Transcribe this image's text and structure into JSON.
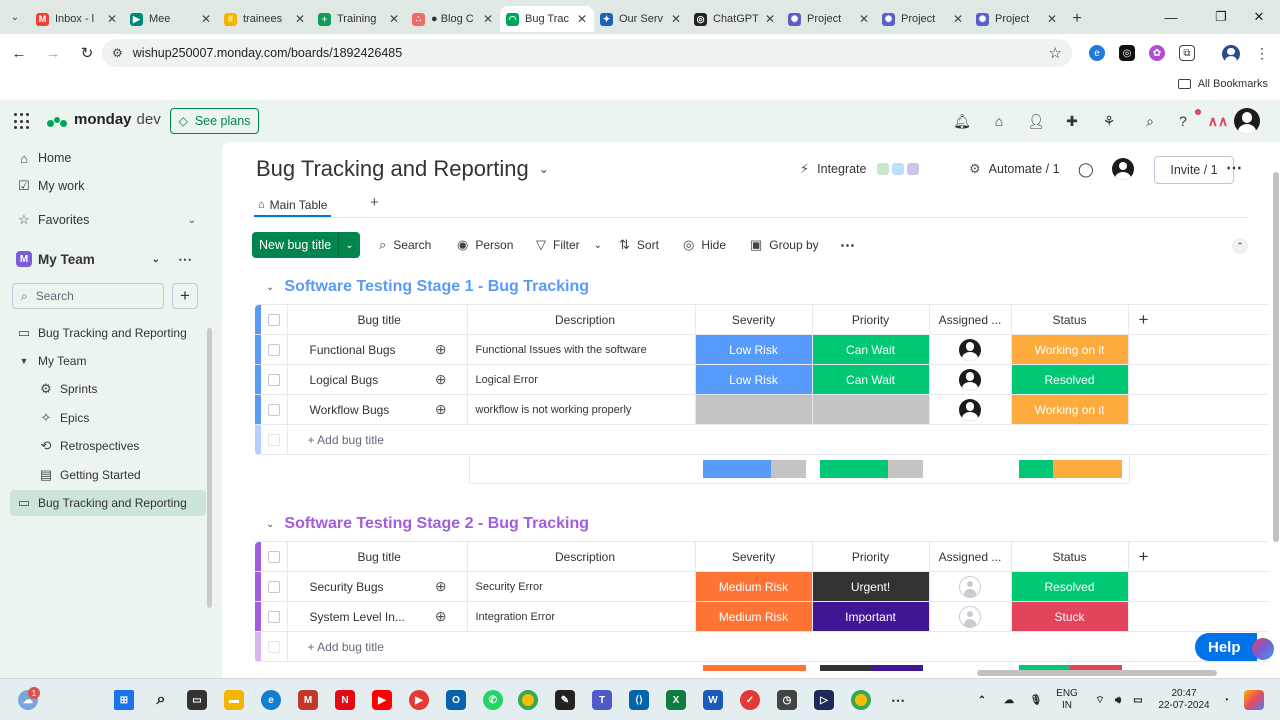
{
  "browser": {
    "tabs": [
      {
        "title": "Inbox - l",
        "color": "#ea4335",
        "glyph": "M"
      },
      {
        "title": "Mee",
        "color": "#00897b",
        "glyph": "▶"
      },
      {
        "title": "trainees",
        "color": "#f6b400",
        "glyph": "#"
      },
      {
        "title": "Training",
        "color": "#0f9d58",
        "glyph": "+"
      },
      {
        "title": "● Blog C",
        "color": "#f06a6a",
        "glyph": "∴"
      },
      {
        "title": "Bug Trac",
        "color": "#00a657",
        "glyph": "◠"
      },
      {
        "title": "Our Serv",
        "color": "#1e63b8",
        "glyph": "✦"
      },
      {
        "title": "ChatGPT",
        "color": "#222222",
        "glyph": "◎"
      },
      {
        "title": "Project",
        "color": "#5b5fc7",
        "glyph": "✺"
      },
      {
        "title": "Project",
        "color": "#5b5fc7",
        "glyph": "✺"
      },
      {
        "title": "Project",
        "color": "#5b5fc7",
        "glyph": "✺"
      }
    ],
    "url": "wishup250007.monday.com/boards/1892426485",
    "all_bookmarks": "All Bookmarks"
  },
  "topbar": {
    "brand": "monday",
    "product": "dev",
    "see_plans": "See plans"
  },
  "sidebar": {
    "home": "Home",
    "my_work": "My work",
    "favorites": "Favorites",
    "team": "My Team",
    "team_badge": "M",
    "search_placeholder": "Search",
    "items": [
      {
        "label": "Bug Tracking and Reporting"
      },
      {
        "label": "My Team"
      },
      {
        "label": "Sprints"
      },
      {
        "label": "Epics"
      },
      {
        "label": "Retrospectives"
      },
      {
        "label": "Getting Started"
      },
      {
        "label": "Bug Tracking and Reporting"
      }
    ]
  },
  "board": {
    "title": "Bug Tracking and Reporting",
    "integrate": "Integrate",
    "automate": "Automate / 1",
    "invite": "Invite / 1",
    "main_tab": "Main Table",
    "toolbar": {
      "new_item": "New bug title",
      "search": "Search",
      "person": "Person",
      "filter": "Filter",
      "sort": "Sort",
      "hide": "Hide",
      "group_by": "Group by"
    },
    "columns": {
      "name": "Bug title",
      "description": "Description",
      "severity": "Severity",
      "priority": "Priority",
      "assigned": "Assigned ...",
      "status": "Status"
    },
    "add_row": "+ Add bug title",
    "groups": [
      {
        "title": "Software Testing Stage 1 - Bug Tracking",
        "color": "#579bfc",
        "rows": [
          {
            "name": "Functional Bugs",
            "description": "Functional Issues with the software",
            "severity": "Low Risk",
            "severity_color": "#579bfc",
            "priority": "Can Wait",
            "priority_color": "#00c875",
            "status": "Working on it",
            "status_color": "#fdab3d"
          },
          {
            "name": "Logical Bugs",
            "description": "Logical Error",
            "severity": "Low Risk",
            "severity_color": "#579bfc",
            "priority": "Can Wait",
            "priority_color": "#00c875",
            "status": "Resolved",
            "status_color": "#00c875"
          },
          {
            "name": "Workflow Bugs",
            "description": "workflow is not working properly",
            "severity": "",
            "severity_color": "#c4c4c4",
            "priority": "",
            "priority_color": "#c4c4c4",
            "status": "Working on it",
            "status_color": "#fdab3d"
          }
        ]
      },
      {
        "title": "Software Testing Stage 2 - Bug Tracking",
        "color": "#a25ddc",
        "rows": [
          {
            "name": "Security Bugs",
            "description": "Security Error",
            "severity": "Medium Risk",
            "severity_color": "#ff7434",
            "priority": "Urgent!",
            "priority_color": "#333333",
            "status": "Resolved",
            "status_color": "#00c875"
          },
          {
            "name": "System Level In...",
            "description": "Integration Error",
            "severity": "Medium Risk",
            "severity_color": "#ff7434",
            "priority": "Important",
            "priority_color": "#401694",
            "status": "Stuck",
            "status_color": "#e2445c"
          }
        ]
      }
    ],
    "help": "Help"
  },
  "taskbar": {
    "lang": "ENG",
    "region": "IN",
    "time": "20:47",
    "date": "22-07-2024",
    "weather_badge": "1"
  }
}
